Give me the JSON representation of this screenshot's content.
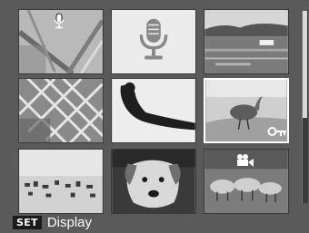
{
  "footer": {
    "badge_label": "SET",
    "action_label": "Display"
  },
  "thumbnails": [
    {
      "content": "photo",
      "overlay_icon": "voice-memo-icon"
    },
    {
      "content": "microphone-icon"
    },
    {
      "content": "photo"
    },
    {
      "content": "photo"
    },
    {
      "content": "photo"
    },
    {
      "content": "photo",
      "overlay_icon": "key-icon",
      "selected": true
    },
    {
      "content": "photo"
    },
    {
      "content": "photo"
    },
    {
      "content": "photo",
      "overlay_icon": "movie-camera-icon"
    }
  ],
  "colors": {
    "background": "#5a5a5a",
    "selection_border": "#ffffff",
    "footer_text": "#ffffff"
  }
}
